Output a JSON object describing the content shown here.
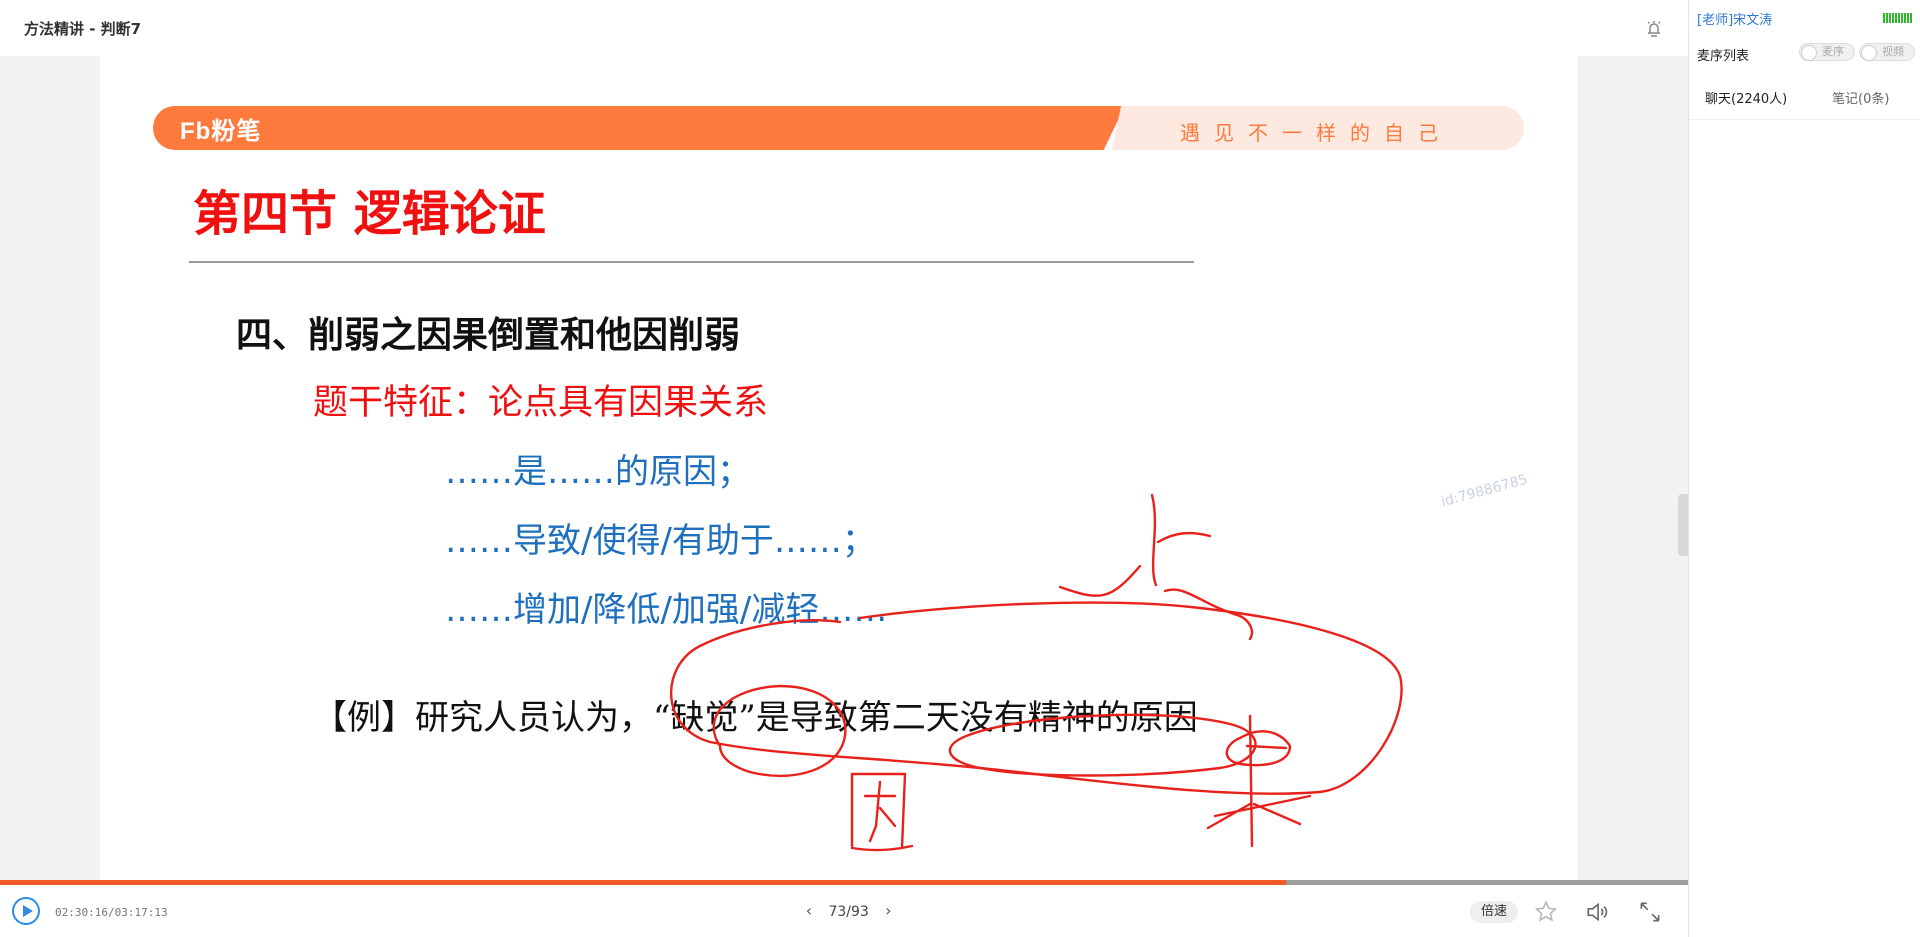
{
  "header": {
    "title": "方法精讲 - 判断7",
    "bell_icon": "alarm-bell-icon"
  },
  "slide": {
    "logo": "Fb粉笔",
    "slogan": "遇见不一样的自己",
    "section_title": "第四节 逻辑论证",
    "heading": "四、削弱之因果倒置和他因削弱",
    "feature": "题干特征：论点具有因果关系",
    "patterns": [
      "……是……的原因；",
      "……导致/使得/有助于……；",
      "……增加/降低/加强/减轻……"
    ],
    "example": "【例】研究人员认为，“缺觉”是导致第二天没有精神的原因",
    "watermark": "id:79886785",
    "ink_color": "#e8221b",
    "brand_color": "#ff7a3d"
  },
  "controls": {
    "time": "02:30:16/03:17:13",
    "page": "73/93",
    "progress": 0.762,
    "speed_label": "倍速",
    "icons": [
      "play-icon",
      "prev-page-icon",
      "next-page-icon",
      "star-icon",
      "volume-icon",
      "fullscreen-icon"
    ]
  },
  "panel": {
    "teacher": "[老师]宋文涛",
    "mic_list": "麦序列表",
    "toggle_mic": "麦序",
    "toggle_video": "视频",
    "tab_chat": "聊天(2240人)",
    "tab_notes": "笔记(0条)"
  }
}
